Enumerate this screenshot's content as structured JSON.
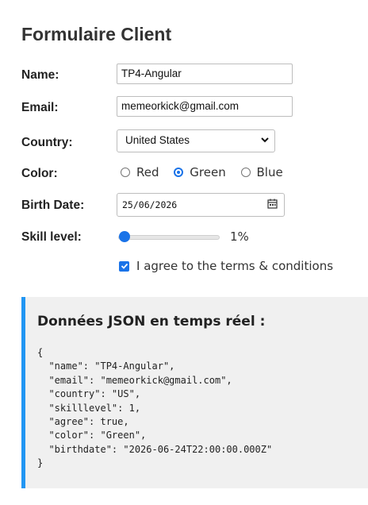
{
  "page": {
    "title": "Formulaire Client"
  },
  "form": {
    "name": {
      "label": "Name:",
      "value": "TP4-Angular"
    },
    "email": {
      "label": "Email:",
      "value": "memeorkick@gmail.com"
    },
    "country": {
      "label": "Country:",
      "selected": "United States"
    },
    "color": {
      "label": "Color:",
      "options": [
        "Red",
        "Green",
        "Blue"
      ],
      "selected": "Green"
    },
    "birth_date": {
      "label": "Birth Date:",
      "value": "25/06/2026",
      "icon": "calendar-icon"
    },
    "skill": {
      "label": "Skill level:",
      "value": 1,
      "display": "1%"
    },
    "agree": {
      "checked": true,
      "label": "I agree to the terms & conditions"
    }
  },
  "json_panel": {
    "title": "Données JSON en temps réel :",
    "content": "{\n  \"name\": \"TP4-Angular\",\n  \"email\": \"memeorkick@gmail.com\",\n  \"country\": \"US\",\n  \"skilllevel\": 1,\n  \"agree\": true,\n  \"color\": \"Green\",\n  \"birthdate\": \"2026-06-24T22:00:00.000Z\"\n}"
  },
  "colors": {
    "accent": "#1a73e8",
    "panel_border": "#2196f3",
    "panel_bg": "#f0f0f0"
  }
}
